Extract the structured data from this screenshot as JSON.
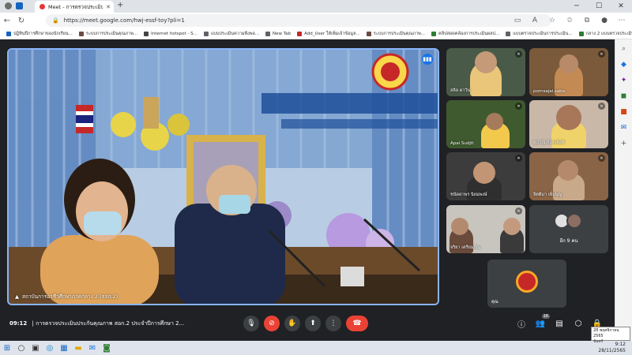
{
  "browser": {
    "tab_title": "Meet - การตรวจประเมินประกัน...",
    "url": "https://meet.google.com/hwj-essf-toy?pli=1"
  },
  "bookmarks": [
    {
      "label": "ปฏิทินปีการศึกษาของนักเรียน...",
      "color": "#1565c0"
    },
    {
      "label": "ระบบการประเมินคุณภาพ...",
      "color": "#6d4c41"
    },
    {
      "label": "Internet hotspot - S...",
      "color": "#444444"
    },
    {
      "label": "แบบประเมินความพึงพอ...",
      "color": "#5f6368"
    },
    {
      "label": "New Tab",
      "color": "#5f6368"
    },
    {
      "label": "Add_User ให้เพิ่มเจ้าข้อมูล...",
      "color": "#c62828"
    },
    {
      "label": "ระบบการประเมินคุณภาพ...",
      "color": "#6d4c41"
    },
    {
      "label": "คลิปสอดคล้องการประเมินผลป...",
      "color": "#2e7d32"
    },
    {
      "label": "แบบตรวจประเมินการประเมิน...",
      "color": "#5f6368"
    },
    {
      "label": "กลาง 2 แบบตรวจประเมิน...",
      "color": "#2e7d32"
    }
  ],
  "main_video": {
    "name": "สถาบันการอาชีวศึกษาภาคกลาง 2 (สอก.2)"
  },
  "tiles": [
    {
      "name": "สลิล ดาวิน"
    },
    {
      "name": "pornsajai.saba"
    },
    {
      "name": "Apai Sudjit"
    },
    {
      "name": "ศุภาณี กังละพิงศ์"
    },
    {
      "name": "ชนัดดาพร นิยมพงษ์"
    },
    {
      "name": "จิตติมา เพิ่มบุญ"
    },
    {
      "name": "จริยา เตรียมกิณ"
    }
  ],
  "others_tile": {
    "label": "อีก 9 คน"
  },
  "self_tile": {
    "label": "คุณ"
  },
  "bottom": {
    "time": "09:12",
    "title": "การตรวจประเมินประกันคุณภาพ สอก.2 ประจำปีการศึกษา 2...",
    "participants_count": "16"
  },
  "taskbar": {
    "time": "9:12",
    "date": "28/11/2565"
  },
  "tooltip": {
    "line1": "28 พฤศจิกายน 2565",
    "line2": "จันทร์"
  },
  "colors": {
    "meet_bg": "#202124",
    "active_border": "#8ab4f8",
    "end_call": "#ea4335",
    "accent_blue": "#1a73e8"
  }
}
